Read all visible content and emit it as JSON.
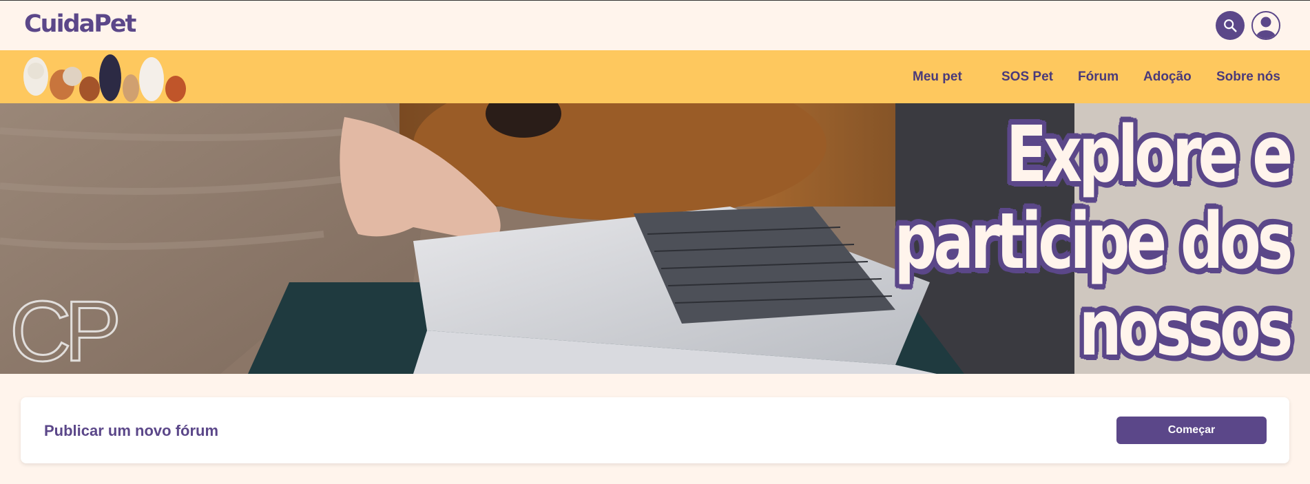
{
  "header": {
    "logo": "CuidaPet",
    "search_icon": "search-icon",
    "profile_icon": "user-profile-icon"
  },
  "nav": {
    "banner_image": "cartoon dogs illustration",
    "items": [
      {
        "label": "Meu pet"
      },
      {
        "label": "SOS Pet"
      },
      {
        "label": "Fórum"
      },
      {
        "label": "Adoção"
      },
      {
        "label": "Sobre nós"
      }
    ]
  },
  "hero": {
    "title_line1": "Explore e",
    "title_line2": "participe dos",
    "title_line3": "nossos Fóruns!",
    "watermark": "CP"
  },
  "card": {
    "title": "Publicar um novo fórum",
    "button_label": "Começar"
  },
  "colors": {
    "brand_purple": "#5b4789",
    "nav_yellow": "#fec85e",
    "background": "#fff4ec"
  }
}
